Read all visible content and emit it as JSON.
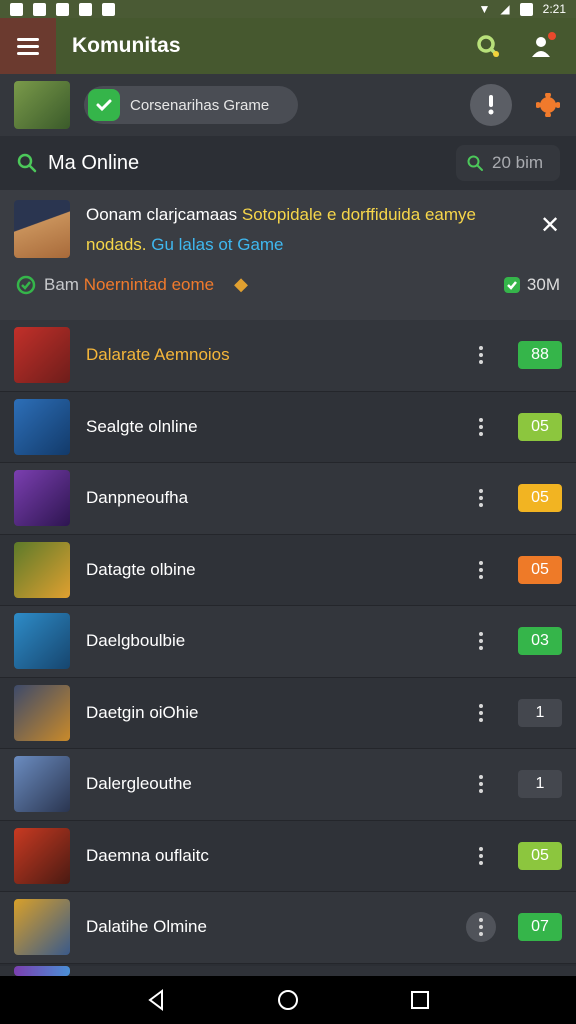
{
  "status_bar": {
    "time": "2:21"
  },
  "app_bar": {
    "title": "Komunitas"
  },
  "filter_bar": {
    "chip_label": "Corsenarihas Grame"
  },
  "search": {
    "title": "Ma Online",
    "pill_text": "20 bim"
  },
  "banner": {
    "text_white": "Oonam clarjcamaas ",
    "text_yellow": "Sotopidale e dorffiduida eamye",
    "text_yellow2": "nodads. ",
    "text_blue": "Gu lalas ot Game",
    "left_label": "Bam ",
    "left_accent": "Noernintad eome",
    "right_value": "30M"
  },
  "games": [
    {
      "name": "Dalarate Aemnoios",
      "count": "88",
      "name_color": "#f5b63a",
      "count_color": "#35b54a",
      "thumb": [
        "#c2302a",
        "#6e1d1a"
      ]
    },
    {
      "name": "Sealgte olnline",
      "count": "05",
      "name_color": "#ffffff",
      "count_color": "#8cc63e",
      "thumb": [
        "#2d6fb8",
        "#123a6a"
      ]
    },
    {
      "name": "Danpneoufha",
      "count": "05",
      "name_color": "#ffffff",
      "count_color": "#f2b422",
      "thumb": [
        "#7b3fb0",
        "#2d1550"
      ]
    },
    {
      "name": "Datagte olbine",
      "count": "05",
      "name_color": "#ffffff",
      "count_color": "#ee7a28",
      "thumb": [
        "#5c7a2a",
        "#e0a030"
      ]
    },
    {
      "name": "Daelgboulbie",
      "count": "03",
      "name_color": "#ffffff",
      "count_color": "#35b54a",
      "thumb": [
        "#2e8cc8",
        "#16456e"
      ]
    },
    {
      "name": "Daetgin oiOhie",
      "count": "1",
      "name_color": "#ffffff",
      "count_color": "#44474e",
      "thumb": [
        "#3d4a6a",
        "#c98a2a"
      ]
    },
    {
      "name": "Dalergleouthe",
      "count": "1",
      "name_color": "#ffffff",
      "count_color": "#44474e",
      "thumb": [
        "#6b8cc0",
        "#2a3550"
      ]
    },
    {
      "name": "Daemna ouflaitc",
      "count": "05",
      "name_color": "#ffffff",
      "count_color": "#8cc63e",
      "thumb": [
        "#c83a22",
        "#4a1a12"
      ]
    },
    {
      "name": "Dalatihe Olmine",
      "count": "07",
      "name_color": "#ffffff",
      "count_color": "#35b54a",
      "thumb": [
        "#d8a02a",
        "#3a5a8a"
      ]
    }
  ]
}
